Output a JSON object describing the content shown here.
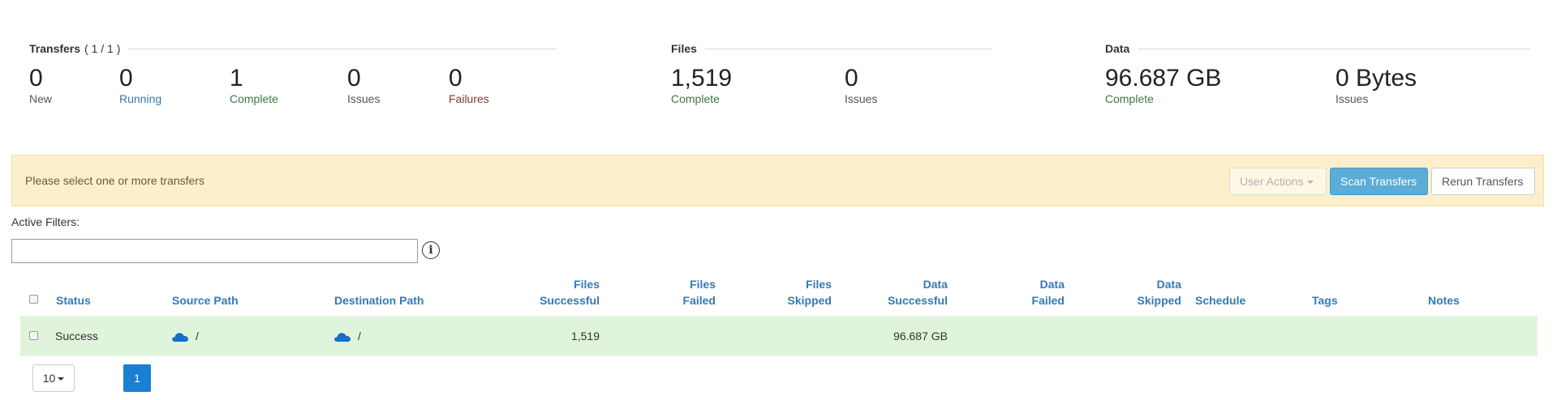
{
  "transfers": {
    "title": "Transfers",
    "count": "( 1 / 1 )",
    "stats": [
      {
        "value": "0",
        "label": "New"
      },
      {
        "value": "0",
        "label": "Running"
      },
      {
        "value": "1",
        "label": "Complete"
      },
      {
        "value": "0",
        "label": "Issues"
      },
      {
        "value": "0",
        "label": "Failures"
      }
    ]
  },
  "files": {
    "title": "Files",
    "stats": [
      {
        "value": "1,519",
        "label": "Complete"
      },
      {
        "value": "0",
        "label": "Issues"
      }
    ]
  },
  "data": {
    "title": "Data",
    "stats": [
      {
        "value": "96.687 GB",
        "label": "Complete"
      },
      {
        "value": "0 Bytes",
        "label": "Issues"
      }
    ]
  },
  "alert": {
    "message": "Please select one or more transfers",
    "user_actions": "User Actions",
    "scan": "Scan Transfers",
    "rerun": "Rerun Transfers"
  },
  "filters": {
    "label": "Active Filters:",
    "value": "",
    "info_glyph": "i"
  },
  "table": {
    "headers": {
      "status": "Status",
      "source_path": "Source Path",
      "destination_path": "Destination Path",
      "files_successful": [
        "Files",
        "Successful"
      ],
      "files_failed": [
        "Files",
        "Failed"
      ],
      "files_skipped": [
        "Files",
        "Skipped"
      ],
      "data_successful": [
        "Data",
        "Successful"
      ],
      "data_failed": [
        "Data",
        "Failed"
      ],
      "data_skipped": [
        "Data",
        "Skipped"
      ],
      "schedule": "Schedule",
      "tags": "Tags",
      "notes": "Notes"
    },
    "rows": [
      {
        "status": "Success",
        "source_path": "/",
        "destination_path": "/",
        "files_successful": "1,519",
        "files_failed": "",
        "files_skipped": "",
        "data_successful": "96.687 GB",
        "data_failed": "",
        "data_skipped": "",
        "schedule": "",
        "tags": "",
        "notes": ""
      }
    ]
  },
  "pagination": {
    "page_size": "10",
    "current_page": "1"
  },
  "colors": {
    "accent": "#337ab7",
    "row_success_bg": "#e0f4db",
    "alert_bg": "#fcf0cc",
    "scan_button": "#5bacd6",
    "page_active": "#1a7fd4"
  },
  "icons": {
    "cloud": "onedrive-cloud-icon",
    "info": "info-icon",
    "caret": "caret-down-icon"
  }
}
